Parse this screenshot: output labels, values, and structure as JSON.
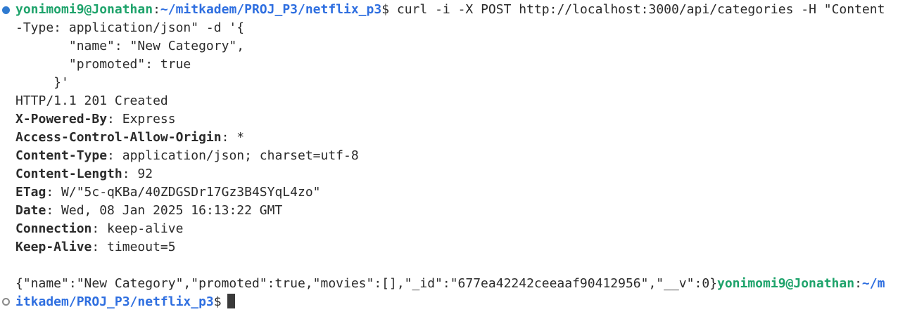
{
  "prompt": {
    "user_host": "yonimomi9@Jonathan",
    "separator": ":",
    "path": "~/mitkadem/PROJ_P3/netflix_p3",
    "symbol": "$"
  },
  "command": {
    "first_line": " curl -i -X POST http://localhost:3000/api/categories -H \"Content",
    "continuation": "-Type: application/json\" -d '{",
    "body_lines": [
      "       \"name\": \"New Category\",",
      "       \"promoted\": true",
      "     }'"
    ]
  },
  "response": {
    "status_line": "HTTP/1.1 201 Created",
    "headers": [
      {
        "key": "X-Powered-By",
        "value": " Express"
      },
      {
        "key": "Access-Control-Allow-Origin",
        "value": " *"
      },
      {
        "key": "Content-Type",
        "value": " application/json; charset=utf-8"
      },
      {
        "key": "Content-Length",
        "value": " 92"
      },
      {
        "key": "ETag",
        "value": " W/\"5c-qKBa/40ZDGSDr17Gz3B4SYqL4zo\""
      },
      {
        "key": "Date",
        "value": " Wed, 08 Jan 2025 16:13:22 GMT"
      },
      {
        "key": "Connection",
        "value": " keep-alive"
      },
      {
        "key": "Keep-Alive",
        "value": " timeout=5"
      }
    ],
    "body": "{\"name\":\"New Category\",\"promoted\":true,\"movies\":[],\"_id\":\"677ea42242ceeaaf90412956\",\"__v\":0}"
  },
  "next_prompt": {
    "user_host": "yonimomi9@Jonathan",
    "separator": ":",
    "path_first": "~/m",
    "path_rest": "itkadem/PROJ_P3/netflix_p3",
    "symbol": "$"
  },
  "colors": {
    "user_host": "#1ea36b",
    "path": "#2f6fe0",
    "success_dot": "#2f7ad0",
    "idle_dot": "#8a8a8a",
    "text": "#2b2b2b",
    "background": "#ffffff"
  },
  "icons": {
    "command_status": "filled-circle-icon",
    "next_command_status": "hollow-circle-icon"
  }
}
